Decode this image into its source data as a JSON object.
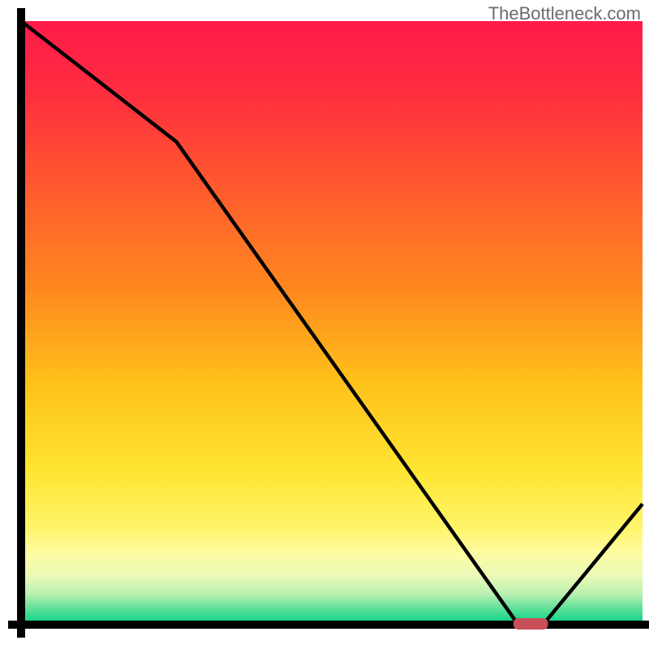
{
  "watermark": "TheBottleneck.com",
  "chart_data": {
    "type": "line",
    "title": "",
    "xlabel": "",
    "ylabel": "",
    "xlim": [
      0,
      100
    ],
    "ylim": [
      0,
      100
    ],
    "x": [
      0,
      5,
      25,
      80,
      84,
      100
    ],
    "y": [
      100,
      96,
      80,
      0,
      0,
      20
    ],
    "optimal_marker": {
      "x_start": 80,
      "x_end": 84,
      "y": 0
    },
    "gradient_stops": [
      {
        "offset": 0.0,
        "color": "#ff1a4a"
      },
      {
        "offset": 0.12,
        "color": "#ff2e3f"
      },
      {
        "offset": 0.28,
        "color": "#ff5b2d"
      },
      {
        "offset": 0.45,
        "color": "#ff8a1e"
      },
      {
        "offset": 0.6,
        "color": "#ffc21a"
      },
      {
        "offset": 0.75,
        "color": "#ffe634"
      },
      {
        "offset": 0.84,
        "color": "#fff56a"
      },
      {
        "offset": 0.88,
        "color": "#fffca0"
      },
      {
        "offset": 0.92,
        "color": "#e9f9b8"
      },
      {
        "offset": 0.95,
        "color": "#b8f0b0"
      },
      {
        "offset": 0.97,
        "color": "#6be29c"
      },
      {
        "offset": 1.0,
        "color": "#00d184"
      }
    ],
    "axis_color": "#000000",
    "curve_color": "#000000",
    "marker_color": "#c94f57"
  }
}
